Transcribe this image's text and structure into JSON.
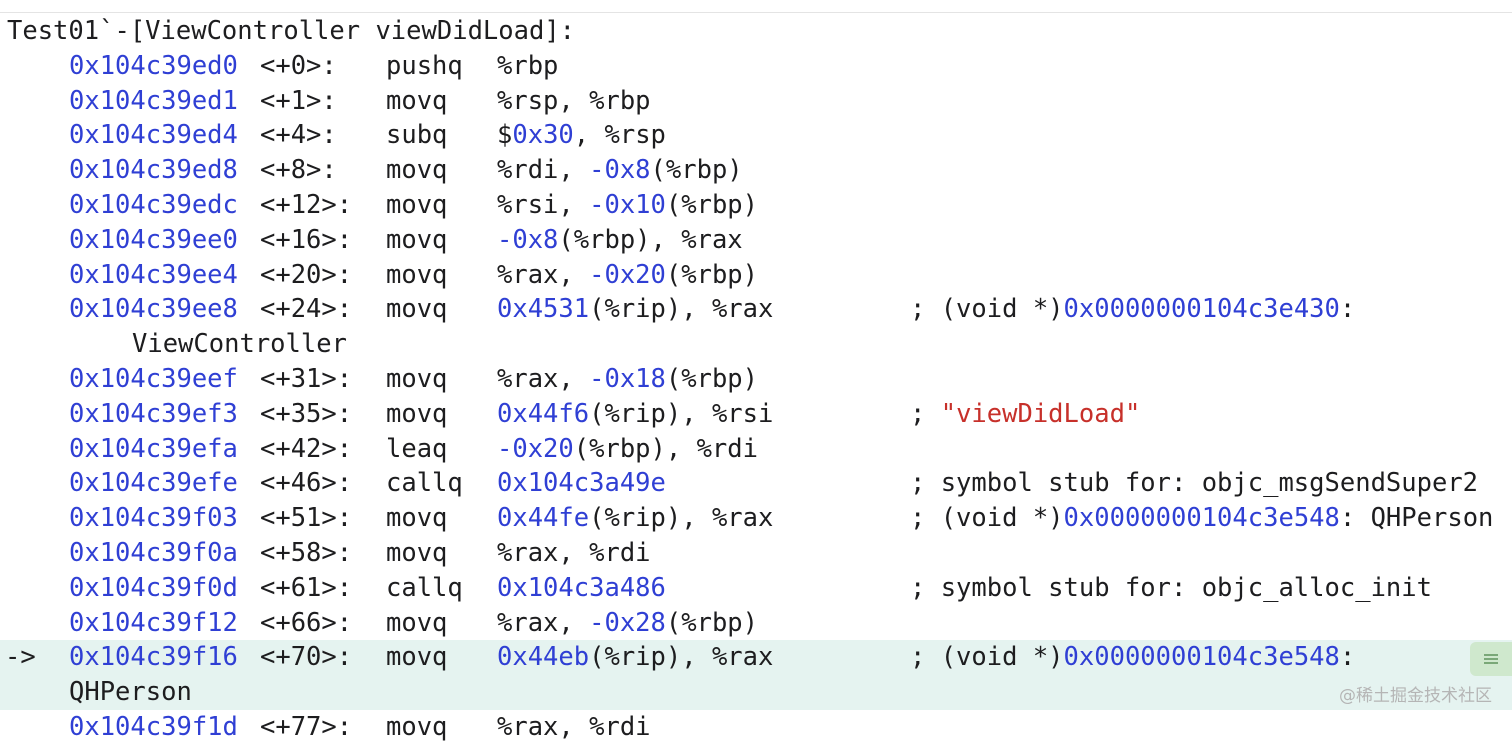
{
  "header": "Test01`-[ViewController viewDidLoad]:",
  "pc_arrow": "->",
  "watermark": "@稀土掘金技术社区",
  "rows": [
    {
      "addr": "0x104c39ed0",
      "off": "<+0>:",
      "mn": "pushq",
      "op": [
        {
          "t": "%rbp",
          "k": "plain"
        }
      ]
    },
    {
      "addr": "0x104c39ed1",
      "off": "<+1>:",
      "mn": "movq",
      "op": [
        {
          "t": "%rsp, %rbp",
          "k": "plain"
        }
      ]
    },
    {
      "addr": "0x104c39ed4",
      "off": "<+4>:",
      "mn": "subq",
      "op": [
        {
          "t": "$",
          "k": "plain"
        },
        {
          "t": "0x30",
          "k": "num"
        },
        {
          "t": ", %rsp",
          "k": "plain"
        }
      ]
    },
    {
      "addr": "0x104c39ed8",
      "off": "<+8>:",
      "mn": "movq",
      "op": [
        {
          "t": "%rdi, ",
          "k": "plain"
        },
        {
          "t": "-0x8",
          "k": "num"
        },
        {
          "t": "(%rbp)",
          "k": "plain"
        }
      ]
    },
    {
      "addr": "0x104c39edc",
      "off": "<+12>:",
      "mn": "movq",
      "op": [
        {
          "t": "%rsi, ",
          "k": "plain"
        },
        {
          "t": "-0x10",
          "k": "num"
        },
        {
          "t": "(%rbp)",
          "k": "plain"
        }
      ]
    },
    {
      "addr": "0x104c39ee0",
      "off": "<+16>:",
      "mn": "movq",
      "op": [
        {
          "t": "-0x8",
          "k": "num"
        },
        {
          "t": "(%rbp), %rax",
          "k": "plain"
        }
      ]
    },
    {
      "addr": "0x104c39ee4",
      "off": "<+20>:",
      "mn": "movq",
      "op": [
        {
          "t": "%rax, ",
          "k": "plain"
        },
        {
          "t": "-0x20",
          "k": "num"
        },
        {
          "t": "(%rbp)",
          "k": "plain"
        }
      ]
    },
    {
      "addr": "0x104c39ee8",
      "off": "<+24>:",
      "mn": "movq",
      "op": [
        {
          "t": "0x4531",
          "k": "num"
        },
        {
          "t": "(%rip), %rax",
          "k": "plain"
        }
      ],
      "cm": [
        {
          "t": "; (void *)",
          "k": "plain"
        },
        {
          "t": "0x0000000104c3e430",
          "k": "num"
        },
        {
          "t": ":",
          "k": "plain"
        }
      ],
      "cont": "ViewController",
      "cont_col": "c-cont"
    },
    {
      "addr": "0x104c39eef",
      "off": "<+31>:",
      "mn": "movq",
      "op": [
        {
          "t": "%rax, ",
          "k": "plain"
        },
        {
          "t": "-0x18",
          "k": "num"
        },
        {
          "t": "(%rbp)",
          "k": "plain"
        }
      ]
    },
    {
      "addr": "0x104c39ef3",
      "off": "<+35>:",
      "mn": "movq",
      "op": [
        {
          "t": "0x44f6",
          "k": "num"
        },
        {
          "t": "(%rip), %rsi",
          "k": "plain"
        }
      ],
      "cm": [
        {
          "t": "; ",
          "k": "plain"
        },
        {
          "t": "\"viewDidLoad\"",
          "k": "str"
        }
      ]
    },
    {
      "addr": "0x104c39efa",
      "off": "<+42>:",
      "mn": "leaq",
      "op": [
        {
          "t": "-0x20",
          "k": "num"
        },
        {
          "t": "(%rbp), %rdi",
          "k": "plain"
        }
      ]
    },
    {
      "addr": "0x104c39efe",
      "off": "<+46>:",
      "mn": "callq",
      "op": [
        {
          "t": "0x104c3a49e",
          "k": "num"
        }
      ],
      "cm": [
        {
          "t": "; symbol stub for: objc_msgSendSuper2",
          "k": "plain"
        }
      ]
    },
    {
      "addr": "0x104c39f03",
      "off": "<+51>:",
      "mn": "movq",
      "op": [
        {
          "t": "0x44fe",
          "k": "num"
        },
        {
          "t": "(%rip), %rax",
          "k": "plain"
        }
      ],
      "cm": [
        {
          "t": "; (void *)",
          "k": "plain"
        },
        {
          "t": "0x0000000104c3e548",
          "k": "num"
        },
        {
          "t": ": QHPerson",
          "k": "plain"
        }
      ]
    },
    {
      "addr": "0x104c39f0a",
      "off": "<+58>:",
      "mn": "movq",
      "op": [
        {
          "t": "%rax, %rdi",
          "k": "plain"
        }
      ]
    },
    {
      "addr": "0x104c39f0d",
      "off": "<+61>:",
      "mn": "callq",
      "op": [
        {
          "t": "0x104c3a486",
          "k": "num"
        }
      ],
      "cm": [
        {
          "t": "; symbol stub for: objc_alloc_init",
          "k": "plain"
        }
      ]
    },
    {
      "addr": "0x104c39f12",
      "off": "<+66>:",
      "mn": "movq",
      "op": [
        {
          "t": "%rax, ",
          "k": "plain"
        },
        {
          "t": "-0x28",
          "k": "num"
        },
        {
          "t": "(%rbp)",
          "k": "plain"
        }
      ]
    },
    {
      "addr": "0x104c39f16",
      "off": "<+70>:",
      "mn": "movq",
      "op": [
        {
          "t": "0x44eb",
          "k": "num"
        },
        {
          "t": "(%rip), %rax",
          "k": "plain"
        }
      ],
      "cm": [
        {
          "t": "; (void *)",
          "k": "plain"
        },
        {
          "t": "0x0000000104c3e548",
          "k": "num"
        },
        {
          "t": ":",
          "k": "plain"
        }
      ],
      "cont": "QHPerson",
      "cont_col": "c-cont2",
      "current": true
    },
    {
      "addr": "0x104c39f1d",
      "off": "<+77>:",
      "mn": "movq",
      "op": [
        {
          "t": "%rax, %rdi",
          "k": "plain"
        }
      ]
    }
  ]
}
